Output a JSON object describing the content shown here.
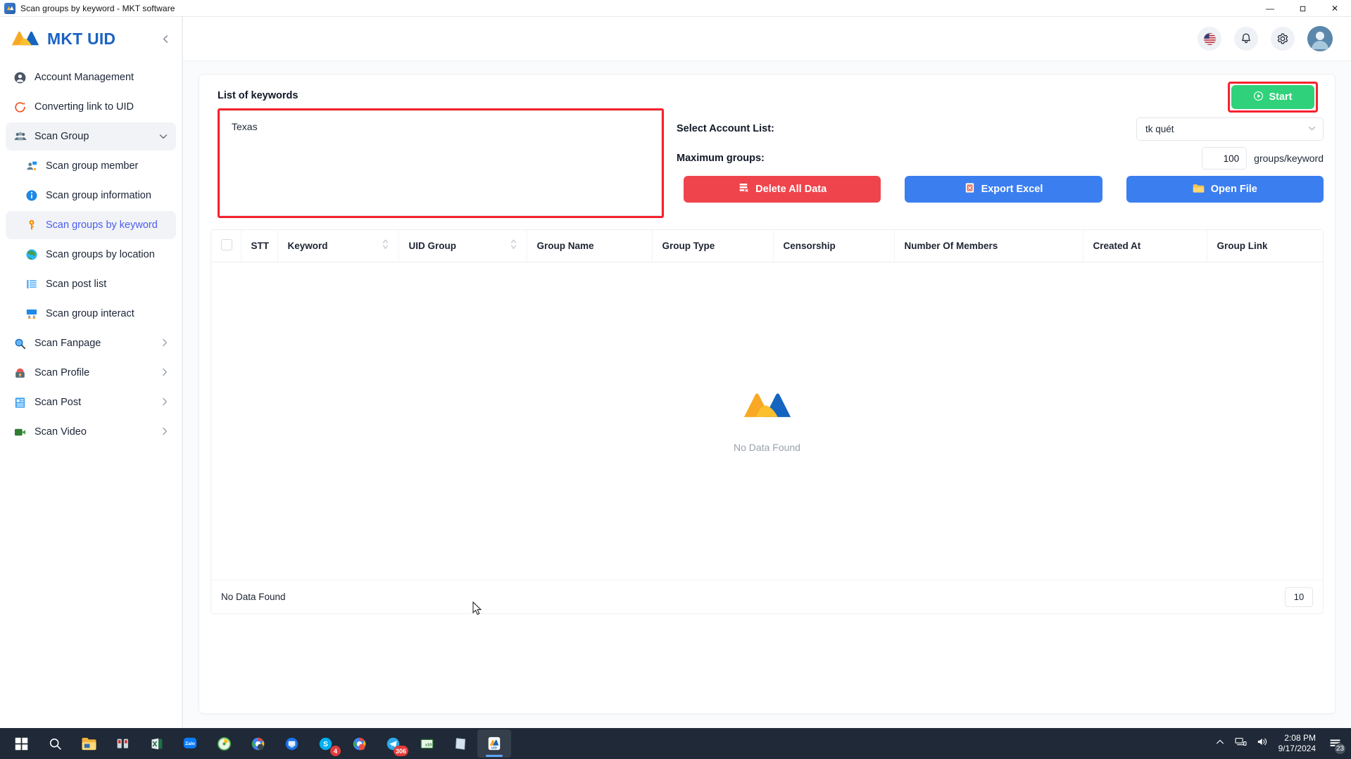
{
  "window": {
    "title": "Scan groups by keyword - MKT software",
    "app_icon": "app-icon",
    "minimize": "—",
    "maximize": "❐",
    "close": "✕"
  },
  "sidebar": {
    "brand": "MKT UID",
    "collapse_icon": "chevron-left-icon",
    "items": [
      {
        "label": "Account Management",
        "icon": "user-circle-icon",
        "level": 0,
        "state": "normal",
        "chevron": ""
      },
      {
        "label": "Converting link to UID",
        "icon": "refresh-icon",
        "level": 0,
        "state": "normal",
        "chevron": ""
      },
      {
        "label": "Scan Group",
        "icon": "group-icon",
        "level": 0,
        "state": "expanded",
        "chevron": "⌄"
      },
      {
        "label": "Scan group member",
        "icon": "member-icon",
        "level": 1,
        "state": "normal",
        "chevron": ""
      },
      {
        "label": "Scan group information",
        "icon": "info-icon",
        "level": 1,
        "state": "normal",
        "chevron": ""
      },
      {
        "label": "Scan groups by keyword",
        "icon": "key-icon",
        "level": 1,
        "state": "selected",
        "chevron": ""
      },
      {
        "label": "Scan groups by location",
        "icon": "globe-icon",
        "level": 1,
        "state": "normal",
        "chevron": ""
      },
      {
        "label": "Scan post list",
        "icon": "list-icon",
        "level": 1,
        "state": "normal",
        "chevron": ""
      },
      {
        "label": "Scan group interact",
        "icon": "interact-icon",
        "level": 1,
        "state": "normal",
        "chevron": ""
      },
      {
        "label": "Scan Fanpage",
        "icon": "magnifier-icon",
        "level": 0,
        "state": "collapsed",
        "chevron": "›"
      },
      {
        "label": "Scan Profile",
        "icon": "profile-lock-icon",
        "level": 0,
        "state": "collapsed",
        "chevron": "›"
      },
      {
        "label": "Scan Post",
        "icon": "post-icon",
        "level": 0,
        "state": "collapsed",
        "chevron": "›"
      },
      {
        "label": "Scan Video",
        "icon": "video-icon",
        "level": 0,
        "state": "collapsed",
        "chevron": "›"
      }
    ]
  },
  "topbar": {
    "language_icon": "us-flag-icon",
    "notification_icon": "bell-icon",
    "settings_icon": "gear-icon",
    "avatar_icon": "avatar-icon"
  },
  "form": {
    "keywords_label": "List of keywords",
    "keywords_value": "Texas",
    "keywords_placeholder": "",
    "start_label": "Start",
    "start_icon": "play-circle-icon",
    "account_list_label": "Select Account List:",
    "account_list_value": "tk quét",
    "account_list_arrow": "chevron-down-icon",
    "max_groups_label": "Maximum groups:",
    "max_groups_value": "100",
    "max_groups_unit": "groups/keyword",
    "buttons": [
      {
        "label": "Delete All Data",
        "style": "red",
        "icon": "delete-data-icon"
      },
      {
        "label": "Export Excel",
        "style": "blue",
        "icon": "excel-icon"
      },
      {
        "label": "Open File",
        "style": "blue",
        "icon": "folder-icon"
      }
    ]
  },
  "table": {
    "select_all_icon": "checkbox-icon",
    "columns": [
      {
        "label": "STT",
        "sortable": false
      },
      {
        "label": "Keyword",
        "sortable": true
      },
      {
        "label": "UID Group",
        "sortable": true
      },
      {
        "label": "Group Name",
        "sortable": false
      },
      {
        "label": "Group Type",
        "sortable": false
      },
      {
        "label": "Censorship",
        "sortable": false
      },
      {
        "label": "Number Of Members",
        "sortable": false
      },
      {
        "label": "Created At",
        "sortable": false
      },
      {
        "label": "Group Link",
        "sortable": false
      }
    ],
    "rows": [],
    "empty_text": "No Data Found",
    "empty_logo": "mkt-logo-icon",
    "footer_text": "No Data Found",
    "page_size": "10"
  },
  "taskbar": {
    "items": [
      {
        "name": "start-button",
        "icon": "windows-icon"
      },
      {
        "name": "search-button",
        "icon": "search-icon"
      },
      {
        "name": "file-explorer",
        "icon": "folder-icon"
      },
      {
        "name": "app-shortcut",
        "icon": "tools-icon"
      },
      {
        "name": "excel-app",
        "icon": "excel-icon"
      },
      {
        "name": "zalo-app",
        "icon": "zalo-icon",
        "label": "Zalo"
      },
      {
        "name": "app-green",
        "icon": "green-circle-icon"
      },
      {
        "name": "chrome-profile-1",
        "icon": "chrome-icon"
      },
      {
        "name": "monitor-app",
        "icon": "monitor-icon"
      },
      {
        "name": "skype-app",
        "icon": "skype-icon",
        "badge": "4"
      },
      {
        "name": "chrome-profile-2",
        "icon": "chrome-icon"
      },
      {
        "name": "telegram-app",
        "icon": "telegram-icon",
        "badge": "306"
      },
      {
        "name": "excel-green",
        "icon": "excel-icon"
      },
      {
        "name": "notes-app",
        "icon": "notes-icon"
      },
      {
        "name": "mkt-uid-app",
        "icon": "mkt-uid-icon",
        "active": true
      }
    ],
    "tray": {
      "chevron_icon": "chevron-up-icon",
      "network_icon": "network-icon",
      "volume_icon": "volume-icon",
      "time": "2:08 PM",
      "date": "9/17/2024",
      "notification_icon": "notification-icon",
      "notification_count": "23"
    }
  },
  "colors": {
    "accent_blue": "#3b7ef0",
    "brand_blue": "#1b63c4",
    "danger_red": "#f0444c",
    "success_green": "#2fd27a",
    "highlight_red": "#f5222d",
    "selected_text": "#4a5df0"
  }
}
